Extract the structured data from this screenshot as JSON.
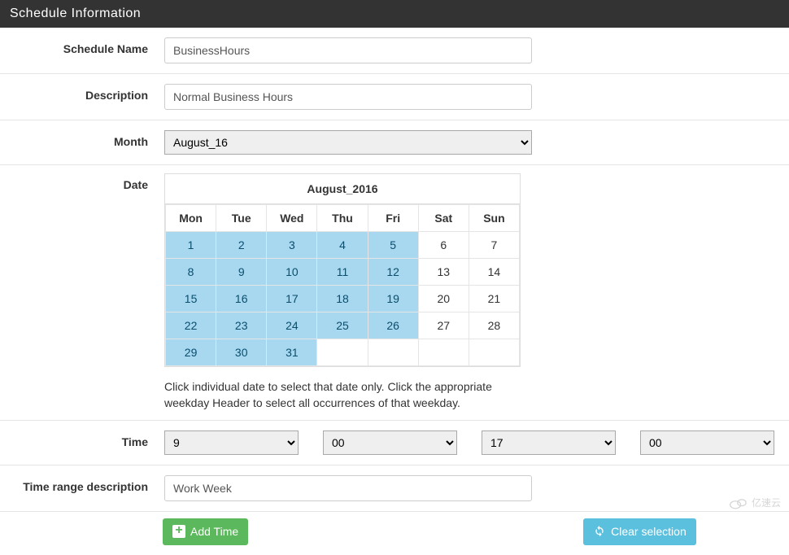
{
  "panelTitle": "Schedule Information",
  "fields": {
    "scheduleNameLabel": "Schedule Name",
    "scheduleNameValue": "BusinessHours",
    "descriptionLabel": "Description",
    "descriptionValue": "Normal Business Hours",
    "monthLabel": "Month",
    "monthValue": "August_16",
    "dateLabel": "Date",
    "timeLabel": "Time",
    "timeRangeDescLabel": "Time range description",
    "timeRangeDescValue": "Work Week"
  },
  "calendar": {
    "title": "August_2016",
    "daysHeader": [
      "Mon",
      "Tue",
      "Wed",
      "Thu",
      "Fri",
      "Sat",
      "Sun"
    ],
    "weeks": [
      [
        {
          "n": "1",
          "sel": true
        },
        {
          "n": "2",
          "sel": true
        },
        {
          "n": "3",
          "sel": true
        },
        {
          "n": "4",
          "sel": true
        },
        {
          "n": "5",
          "sel": true
        },
        {
          "n": "6",
          "sel": false
        },
        {
          "n": "7",
          "sel": false
        }
      ],
      [
        {
          "n": "8",
          "sel": true
        },
        {
          "n": "9",
          "sel": true
        },
        {
          "n": "10",
          "sel": true
        },
        {
          "n": "11",
          "sel": true
        },
        {
          "n": "12",
          "sel": true
        },
        {
          "n": "13",
          "sel": false
        },
        {
          "n": "14",
          "sel": false
        }
      ],
      [
        {
          "n": "15",
          "sel": true
        },
        {
          "n": "16",
          "sel": true
        },
        {
          "n": "17",
          "sel": true
        },
        {
          "n": "18",
          "sel": true
        },
        {
          "n": "19",
          "sel": true
        },
        {
          "n": "20",
          "sel": false
        },
        {
          "n": "21",
          "sel": false
        }
      ],
      [
        {
          "n": "22",
          "sel": true
        },
        {
          "n": "23",
          "sel": true
        },
        {
          "n": "24",
          "sel": true
        },
        {
          "n": "25",
          "sel": true
        },
        {
          "n": "26",
          "sel": true
        },
        {
          "n": "27",
          "sel": false
        },
        {
          "n": "28",
          "sel": false
        }
      ],
      [
        {
          "n": "29",
          "sel": true
        },
        {
          "n": "30",
          "sel": true
        },
        {
          "n": "31",
          "sel": true
        },
        {
          "n": "",
          "sel": false
        },
        {
          "n": "",
          "sel": false
        },
        {
          "n": "",
          "sel": false
        },
        {
          "n": "",
          "sel": false
        }
      ]
    ],
    "helpText": "Click individual date to select that date only. Click the appropriate weekday Header to select all occurrences of that weekday."
  },
  "time": {
    "startHour": "9",
    "startMin": "00",
    "endHour": "17",
    "endMin": "00"
  },
  "buttons": {
    "addTime": "Add Time",
    "clearSelection": "Clear selection"
  },
  "watermark": "亿速云"
}
